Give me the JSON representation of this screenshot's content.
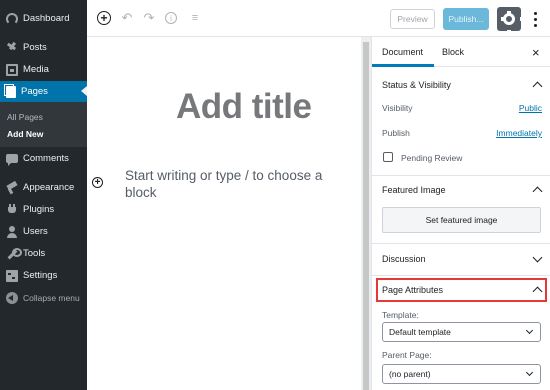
{
  "admin_menu": {
    "items": [
      {
        "label": "Dashboard",
        "icon": "dashboard-icon"
      },
      {
        "label": "Posts",
        "icon": "pin-icon"
      },
      {
        "label": "Media",
        "icon": "media-icon"
      },
      {
        "label": "Pages",
        "icon": "pages-icon",
        "active": true
      },
      {
        "label": "Comments",
        "icon": "comments-icon"
      },
      {
        "label": "Appearance",
        "icon": "appearance-icon"
      },
      {
        "label": "Plugins",
        "icon": "plugins-icon"
      },
      {
        "label": "Users",
        "icon": "users-icon"
      },
      {
        "label": "Tools",
        "icon": "tools-icon"
      },
      {
        "label": "Settings",
        "icon": "settings-icon"
      },
      {
        "label": "Collapse menu",
        "icon": "collapse-icon"
      }
    ],
    "pages_submenu": [
      "All Pages",
      "Add New"
    ],
    "active_color": "#0073aa",
    "background": "#23282d"
  },
  "toolbar": {
    "icons": [
      "add-block-icon",
      "undo-icon",
      "redo-icon",
      "info-icon",
      "list-view-icon"
    ],
    "preview_label": "Preview",
    "publish_label": "Publish...",
    "settings_icon": "gear-icon",
    "more_icon": "more-vertical-icon"
  },
  "editor": {
    "title_placeholder": "Add title",
    "block_placeholder": "Start writing or type / to choose a block"
  },
  "settings_panel": {
    "tabs": [
      "Document",
      "Block"
    ],
    "active_tab": "Document",
    "status_visibility": {
      "title": "Status & Visibility",
      "visibility_label": "Visibility",
      "visibility_value": "Public",
      "publish_label": "Publish",
      "publish_value": "Immediately",
      "pending_review_label": "Pending Review",
      "pending_review_checked": false
    },
    "featured_image": {
      "title": "Featured Image",
      "button_label": "Set featured image"
    },
    "discussion": {
      "title": "Discussion"
    },
    "page_attributes": {
      "title": "Page Attributes",
      "template_label": "Template:",
      "template_value": "Default template",
      "parent_label": "Parent Page:",
      "parent_value": "(no parent)",
      "highlight_color": "#e53935"
    }
  }
}
